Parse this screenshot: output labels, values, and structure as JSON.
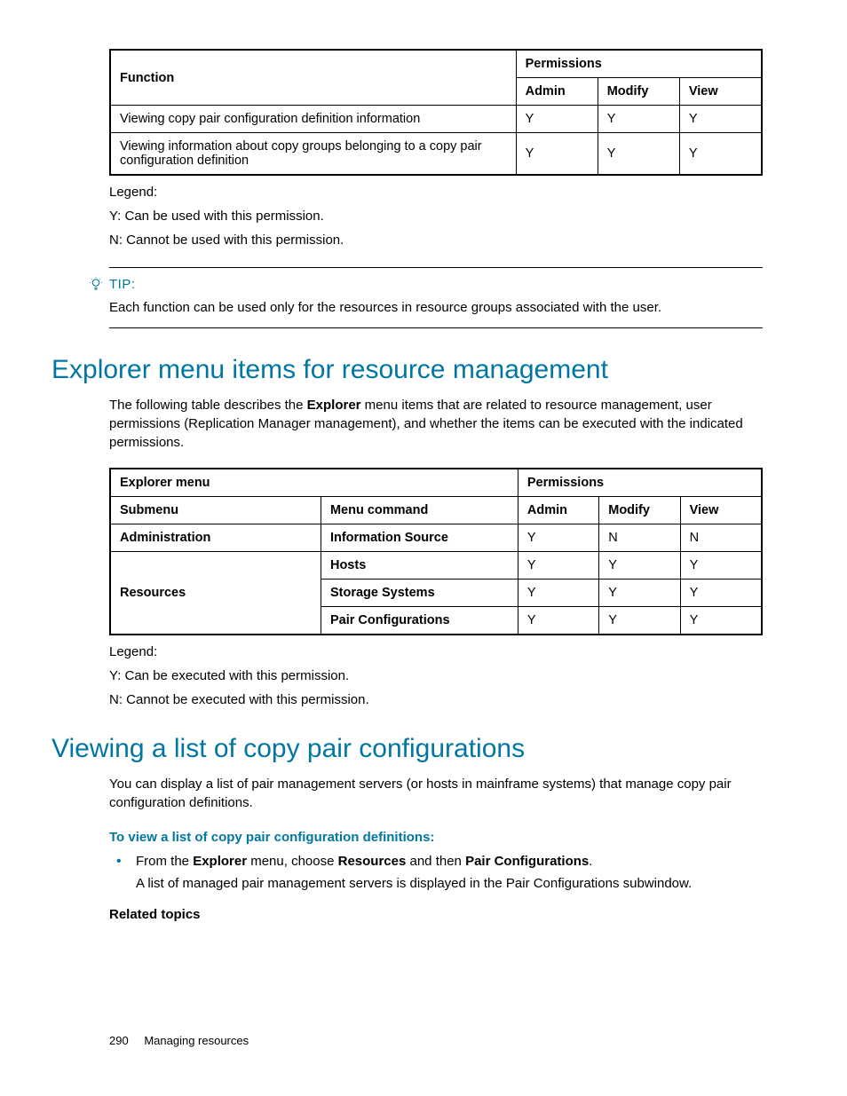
{
  "table1": {
    "header_function": "Function",
    "header_permissions": "Permissions",
    "header_admin": "Admin",
    "header_modify": "Modify",
    "header_view": "View",
    "rows": [
      {
        "func": "Viewing copy pair configuration definition information",
        "admin": "Y",
        "modify": "Y",
        "view": "Y"
      },
      {
        "func": "Viewing information about copy groups belonging to a copy pair configuration definition",
        "admin": "Y",
        "modify": "Y",
        "view": "Y"
      }
    ]
  },
  "legend1": {
    "title": "Legend:",
    "y": "Y: Can be used with this permission.",
    "n": "N: Cannot be used with this permission."
  },
  "tip": {
    "label": "TIP:",
    "text": "Each function can be used only for the resources in resource groups associated with the user."
  },
  "section1": {
    "heading": "Explorer menu items for resource management",
    "intro_pre": "The following table describes the ",
    "intro_bold1": "Explorer",
    "intro_post": " menu items that are related to resource management, user permissions (Replication Manager management), and whether the items can be executed with the indicated permissions."
  },
  "table2": {
    "header_explorer": "Explorer menu",
    "header_permissions": "Permissions",
    "header_submenu": "Submenu",
    "header_command": "Menu command",
    "header_admin": "Admin",
    "header_modify": "Modify",
    "header_view": "View",
    "row_admin_submenu": "Administration",
    "row_admin_cmd": "Information Source",
    "row_admin_a": "Y",
    "row_admin_m": "N",
    "row_admin_v": "N",
    "row_res_submenu": "Resources",
    "row_res_cmd1": "Hosts",
    "row_res1_a": "Y",
    "row_res1_m": "Y",
    "row_res1_v": "Y",
    "row_res_cmd2": "Storage Systems",
    "row_res2_a": "Y",
    "row_res2_m": "Y",
    "row_res2_v": "Y",
    "row_res_cmd3": "Pair Configurations",
    "row_res3_a": "Y",
    "row_res3_m": "Y",
    "row_res3_v": "Y"
  },
  "legend2": {
    "title": "Legend:",
    "y": "Y: Can be executed with this permission.",
    "n": "N: Cannot be executed with this permission."
  },
  "section2": {
    "heading": "Viewing a list of copy pair configurations",
    "intro": "You can display a list of pair management servers (or hosts in mainframe systems) that manage copy pair configuration definitions.",
    "proc_heading": "To view a list of copy pair configuration definitions:",
    "step_pre": "From the ",
    "step_b1": "Explorer",
    "step_mid1": " menu, choose ",
    "step_b2": "Resources",
    "step_mid2": " and then ",
    "step_b3": "Pair Configurations",
    "step_end": ".",
    "result": "A list of managed pair management servers is displayed in the Pair Configurations subwindow.",
    "related": "Related topics"
  },
  "footer": {
    "page": "290",
    "chapter": "Managing resources"
  }
}
